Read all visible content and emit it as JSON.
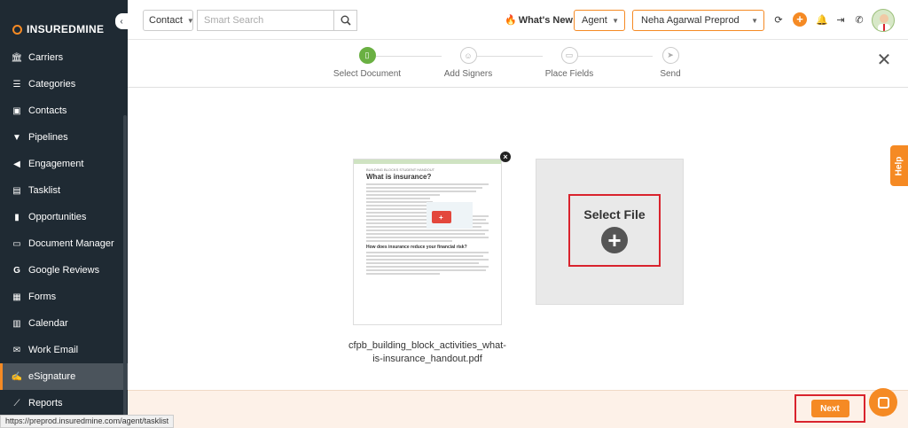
{
  "brand": {
    "name": "INSUREDMINE",
    "accent": "#f58a24"
  },
  "sidebar": {
    "items": [
      {
        "label": "Carriers",
        "icon": "bank-icon"
      },
      {
        "label": "Categories",
        "icon": "list-icon"
      },
      {
        "label": "Contacts",
        "icon": "contact-card-icon"
      },
      {
        "label": "Pipelines",
        "icon": "filter-icon"
      },
      {
        "label": "Engagement",
        "icon": "megaphone-icon"
      },
      {
        "label": "Tasklist",
        "icon": "tasklist-icon"
      },
      {
        "label": "Opportunities",
        "icon": "bar-chart-icon"
      },
      {
        "label": "Document Manager",
        "icon": "folder-icon"
      },
      {
        "label": "Google Reviews",
        "icon": "google-icon"
      },
      {
        "label": "Forms",
        "icon": "form-icon"
      },
      {
        "label": "Calendar",
        "icon": "calendar-icon"
      },
      {
        "label": "Work Email",
        "icon": "mail-icon"
      },
      {
        "label": "eSignature",
        "icon": "signature-icon",
        "active": true
      },
      {
        "label": "Reports",
        "icon": "line-chart-icon"
      }
    ]
  },
  "topbar": {
    "contact_select": "Contact",
    "search_placeholder": "Smart Search",
    "whats_new": "What's New",
    "agent_select": "Agent",
    "user_select": "Neha Agarwal Preprod"
  },
  "stepper": {
    "steps": [
      {
        "label": "Select Document",
        "active": true
      },
      {
        "label": "Add Signers",
        "active": false
      },
      {
        "label": "Place Fields",
        "active": false
      },
      {
        "label": "Send",
        "active": false
      }
    ]
  },
  "document": {
    "kicker": "BUILDING BLOCKS STUDENT HANDOUT",
    "title": "What is insurance?",
    "subheading": "How does insurance reduce your financial risk?",
    "filename": "cfpb_building_block_activities_what-is-insurance_handout.pdf"
  },
  "select_file": {
    "label": "Select File"
  },
  "help_tab": "Help",
  "footer": {
    "next_label": "Next"
  },
  "status_url": "https://preprod.insuredmine.com/agent/tasklist"
}
